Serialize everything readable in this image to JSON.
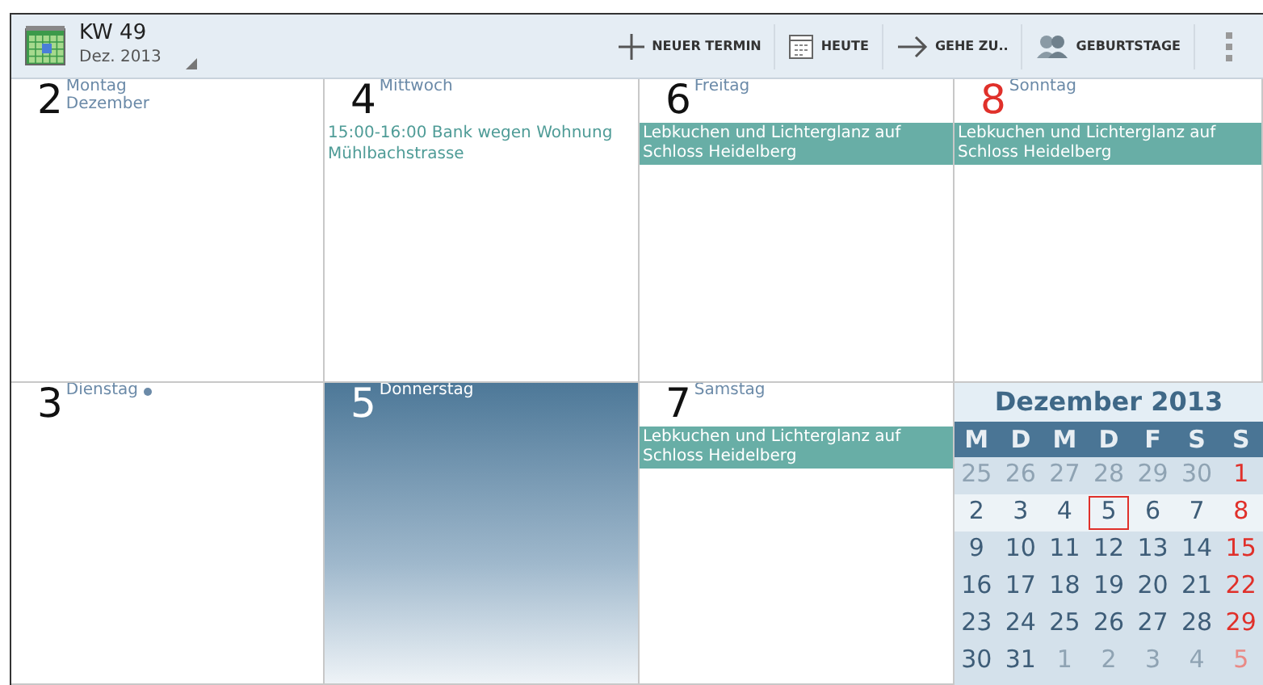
{
  "header": {
    "title": "KW 49",
    "subtitle": "Dez. 2013"
  },
  "actions": [
    {
      "kind": "plus",
      "label": "NEUER TERMIN"
    },
    {
      "kind": "calendar",
      "label": "HEUTE"
    },
    {
      "kind": "arrow",
      "label": "GEHE ZU.."
    },
    {
      "kind": "people",
      "label": "GEBURTSTAGE"
    }
  ],
  "days": [
    {
      "number": "2",
      "weekday": "Montag",
      "month": "Dezember",
      "sunday": false,
      "selected": false,
      "dot": false
    },
    {
      "number": "4",
      "weekday": "Mittwoch",
      "sunday": false,
      "selected": false,
      "dot": false,
      "events": [
        {
          "kind": "timed",
          "text": "15:00-16:00 Bank wegen Wohnung Mühlbachstrasse"
        }
      ]
    },
    {
      "number": "6",
      "weekday": "Freitag",
      "sunday": false,
      "selected": false,
      "dot": false,
      "events": [
        {
          "kind": "allday",
          "text": "Lebkuchen und Lichterglanz auf Schloss Heidelberg"
        }
      ]
    },
    {
      "number": "8",
      "weekday": "Sonntag",
      "sunday": true,
      "selected": false,
      "dot": false,
      "events": [
        {
          "kind": "allday",
          "text": "Lebkuchen und Lichterglanz auf Schloss Heidelberg"
        }
      ]
    },
    {
      "number": "3",
      "weekday": "Dienstag",
      "sunday": false,
      "selected": false,
      "dot": true
    },
    {
      "number": "5",
      "weekday": "Donnerstag",
      "sunday": false,
      "selected": true,
      "dot": false
    },
    {
      "number": "7",
      "weekday": "Samstag",
      "sunday": false,
      "selected": false,
      "dot": false,
      "events": [
        {
          "kind": "allday",
          "text": "Lebkuchen und Lichterglanz auf Schloss Heidelberg"
        }
      ]
    }
  ],
  "mini_calendar": {
    "title": "Dezember 2013",
    "weekdays": [
      "M",
      "D",
      "M",
      "D",
      "F",
      "S",
      "S"
    ],
    "weeks": [
      {
        "current": false,
        "days": [
          {
            "text": "25",
            "muted": true,
            "today": false
          },
          {
            "text": "26",
            "muted": true,
            "today": false
          },
          {
            "text": "27",
            "muted": true,
            "today": false
          },
          {
            "text": "28",
            "muted": true,
            "today": false
          },
          {
            "text": "29",
            "muted": true,
            "today": false
          },
          {
            "text": "30",
            "muted": true,
            "today": false
          },
          {
            "text": "1",
            "muted": false,
            "today": false
          }
        ]
      },
      {
        "current": true,
        "days": [
          {
            "text": "2",
            "muted": false,
            "today": false
          },
          {
            "text": "3",
            "muted": false,
            "today": false
          },
          {
            "text": "4",
            "muted": false,
            "today": false
          },
          {
            "text": "5",
            "muted": false,
            "today": true
          },
          {
            "text": "6",
            "muted": false,
            "today": false
          },
          {
            "text": "7",
            "muted": false,
            "today": false
          },
          {
            "text": "8",
            "muted": false,
            "today": false
          }
        ]
      },
      {
        "current": false,
        "days": [
          {
            "text": "9",
            "muted": false,
            "today": false
          },
          {
            "text": "10",
            "muted": false,
            "today": false
          },
          {
            "text": "11",
            "muted": false,
            "today": false
          },
          {
            "text": "12",
            "muted": false,
            "today": false
          },
          {
            "text": "13",
            "muted": false,
            "today": false
          },
          {
            "text": "14",
            "muted": false,
            "today": false
          },
          {
            "text": "15",
            "muted": false,
            "today": false
          }
        ]
      },
      {
        "current": false,
        "days": [
          {
            "text": "16",
            "muted": false,
            "today": false
          },
          {
            "text": "17",
            "muted": false,
            "today": false
          },
          {
            "text": "18",
            "muted": false,
            "today": false
          },
          {
            "text": "19",
            "muted": false,
            "today": false
          },
          {
            "text": "20",
            "muted": false,
            "today": false
          },
          {
            "text": "21",
            "muted": false,
            "today": false
          },
          {
            "text": "22",
            "muted": false,
            "today": false
          }
        ]
      },
      {
        "current": false,
        "days": [
          {
            "text": "23",
            "muted": false,
            "today": false
          },
          {
            "text": "24",
            "muted": false,
            "today": false
          },
          {
            "text": "25",
            "muted": false,
            "today": false
          },
          {
            "text": "26",
            "muted": false,
            "today": false
          },
          {
            "text": "27",
            "muted": false,
            "today": false
          },
          {
            "text": "28",
            "muted": false,
            "today": false
          },
          {
            "text": "29",
            "muted": false,
            "today": false
          }
        ]
      },
      {
        "current": false,
        "days": [
          {
            "text": "30",
            "muted": false,
            "today": false
          },
          {
            "text": "31",
            "muted": false,
            "today": false
          },
          {
            "text": "1",
            "muted": true,
            "today": false
          },
          {
            "text": "2",
            "muted": true,
            "today": false
          },
          {
            "text": "3",
            "muted": true,
            "today": false
          },
          {
            "text": "4",
            "muted": true,
            "today": false
          },
          {
            "text": "5",
            "muted": true,
            "today": false
          }
        ]
      }
    ]
  }
}
